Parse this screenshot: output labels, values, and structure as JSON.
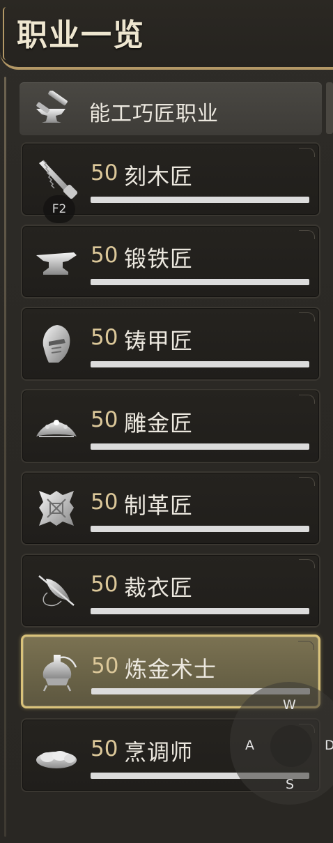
{
  "header": {
    "title": "职业一览"
  },
  "category": {
    "label": "能工巧匠职业",
    "icon": "hammer-anvil-icon"
  },
  "jobs": [
    {
      "level": "50",
      "name": "刻木匠",
      "icon": "saw-icon",
      "progress": 1.0,
      "selected": false
    },
    {
      "level": "50",
      "name": "锻铁匠",
      "icon": "anvil-icon",
      "progress": 1.0,
      "selected": false
    },
    {
      "level": "50",
      "name": "铸甲匠",
      "icon": "helmet-icon",
      "progress": 1.0,
      "selected": false
    },
    {
      "level": "50",
      "name": "雕金匠",
      "icon": "tiara-icon",
      "progress": 1.0,
      "selected": false
    },
    {
      "level": "50",
      "name": "制革匠",
      "icon": "leather-hide-icon",
      "progress": 1.0,
      "selected": false
    },
    {
      "level": "50",
      "name": "裁衣匠",
      "icon": "needle-spool-icon",
      "progress": 1.0,
      "selected": false
    },
    {
      "level": "50",
      "name": "炼金术士",
      "icon": "alembic-icon",
      "progress": 1.0,
      "selected": true
    },
    {
      "level": "50",
      "name": "烹调师",
      "icon": "bread-icon",
      "progress": 1.0,
      "selected": false
    }
  ],
  "keybind": {
    "label": "F2"
  },
  "joystick": {
    "up": "W",
    "left": "A",
    "right": "D",
    "down": "S"
  },
  "colors": {
    "accent_gold": "#b39866",
    "selected_border": "#d9c27a",
    "level_text": "#dcc89a",
    "progress_fill": "#dcdcdc"
  }
}
